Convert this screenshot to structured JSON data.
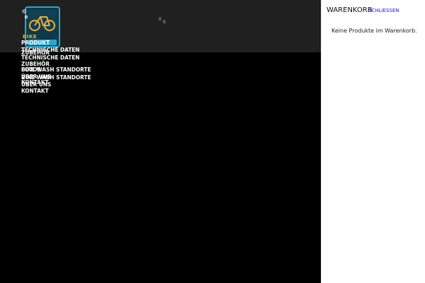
{
  "brand": {
    "logo_text": "BIKE",
    "accent_color": "#f0b030",
    "logo_frame_color": "#2ea6c8"
  },
  "cart_counter": {
    "count_a": "0",
    "count_b": "0"
  },
  "nav": {
    "items": [
      {
        "label": "Produkt"
      },
      {
        "label": "Technische Daten"
      },
      {
        "label": "Zubehör"
      },
      {
        "label": "Technische Daten"
      },
      {
        "label": "Zubehör"
      },
      {
        "label": "Fotos"
      },
      {
        "label": "Bike Wash Standorte"
      },
      {
        "label": "Über uns"
      },
      {
        "label": "Bike Wash Standorte"
      },
      {
        "label": "Kontakt"
      },
      {
        "label": "Über uns"
      },
      {
        "label": "Kontakt"
      }
    ]
  },
  "cart": {
    "title": "WARENKORB",
    "close_label": "SCHLIESSEN",
    "empty_message": "Keine Produkte im Warenkorb."
  },
  "colors": {
    "header_bg": "#202020",
    "page_bg": "#000000",
    "drawer_bg": "#ffffff",
    "link_color": "#1a1ae0"
  }
}
